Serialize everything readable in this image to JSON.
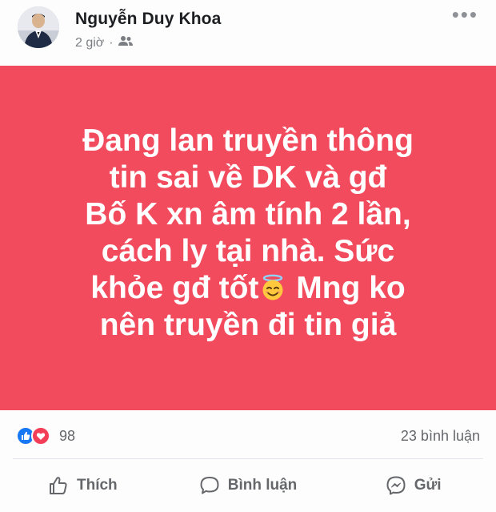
{
  "post": {
    "author_name": "Nguyễn Duy Khoa",
    "time": "2 giờ",
    "separator": "·",
    "audience_icon": "friends-icon",
    "more_icon": "more-options-icon",
    "more_label": "•••",
    "card_color": "#f24b5e",
    "text_lines": [
      "Đang lan truyền thông",
      "tin sai về DK và gđ",
      "Bố K xn âm tính 2 lần,",
      "cách ly tại nhà. Sức",
      "khỏe gđ tốt",
      "Mng ko",
      "nên truyền đi tin giả"
    ],
    "emoji": "smiling-face-with-halo-emoji"
  },
  "reactions": {
    "icons": [
      "like-reaction-icon",
      "love-reaction-icon"
    ],
    "count": "98",
    "comments": "23 bình luận"
  },
  "actions": {
    "like_label": "Thích",
    "comment_label": "Bình luận",
    "share_label": "Gửi"
  }
}
